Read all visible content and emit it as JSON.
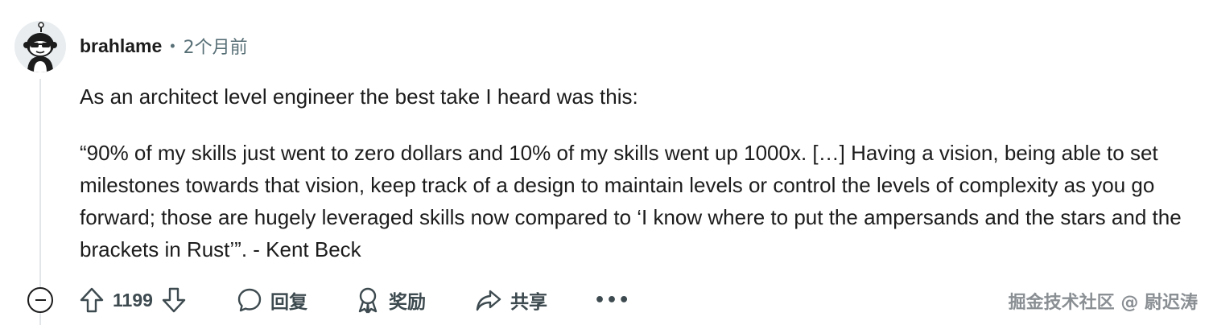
{
  "comment": {
    "author": "brahlame",
    "separator": "•",
    "time_ago": "2个月前",
    "body": [
      "As an architect level engineer the best take I heard was this:",
      "“90% of my skills just went to zero dollars and 10% of my skills went up 1000x. […] Having a vision, being able to set milestones towards that vision, keep track of a design to maintain levels or control the levels of complexity as you go forward; those are hugely leveraged skills now compared to ‘I know where to put the ampersands and the stars and the brackets in Rust’”. - Kent Beck"
    ]
  },
  "actions": {
    "vote_count": "1199",
    "reply_label": "回复",
    "award_label": "奖励",
    "share_label": "共享",
    "more_label": "•••"
  },
  "watermark": "掘金技术社区 @ 尉迟涛",
  "icons": {
    "collapse": "minus-circle-icon",
    "upvote": "arrow-up-icon",
    "downvote": "arrow-down-icon",
    "reply": "speech-bubble-icon",
    "award": "award-ribbon-icon",
    "share": "share-arrow-icon"
  },
  "colors": {
    "text": "#1c1c1c",
    "meta": "#576f76",
    "action": "#3d4a4f",
    "thread_line": "#e3e6e8"
  }
}
